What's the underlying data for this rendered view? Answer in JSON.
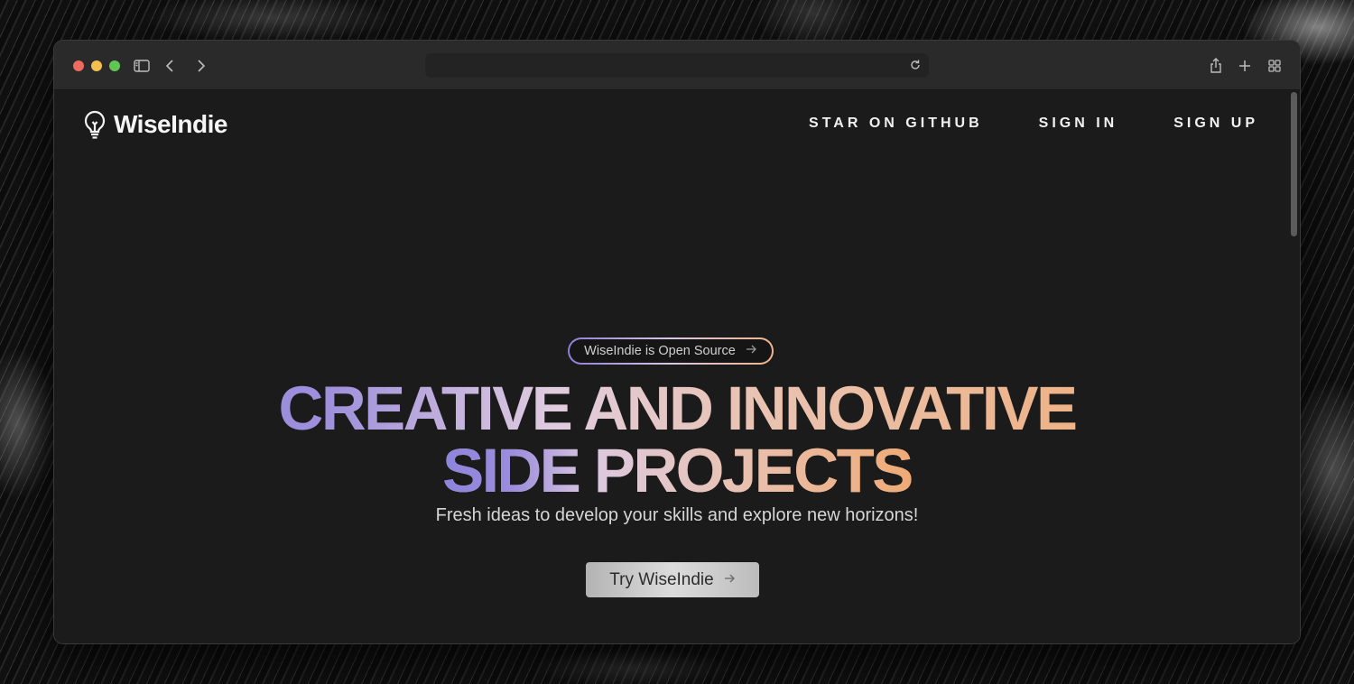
{
  "browser": {
    "icons": [
      "sidebar-icon",
      "back-icon",
      "forward-icon",
      "reload-icon",
      "share-icon",
      "new-tab-icon",
      "tab-overview-icon"
    ]
  },
  "site": {
    "logo_text": "WiseIndie",
    "nav": [
      "STAR ON GITHUB",
      "SIGN IN",
      "SIGN UP"
    ],
    "badge": "WiseIndie is Open Source",
    "headline_line1": "CREATIVE AND INNOVATIVE",
    "headline_line2": "SIDE PROJECTS",
    "subtitle": "Fresh ideas to develop your skills and explore new horizons!",
    "cta": "Try WiseIndie"
  },
  "colors": {
    "page_bg": "#1b1b1b",
    "gradient_start": "#8d84dc",
    "gradient_mid": "#e0ccdf",
    "gradient_end": "#efa871"
  }
}
